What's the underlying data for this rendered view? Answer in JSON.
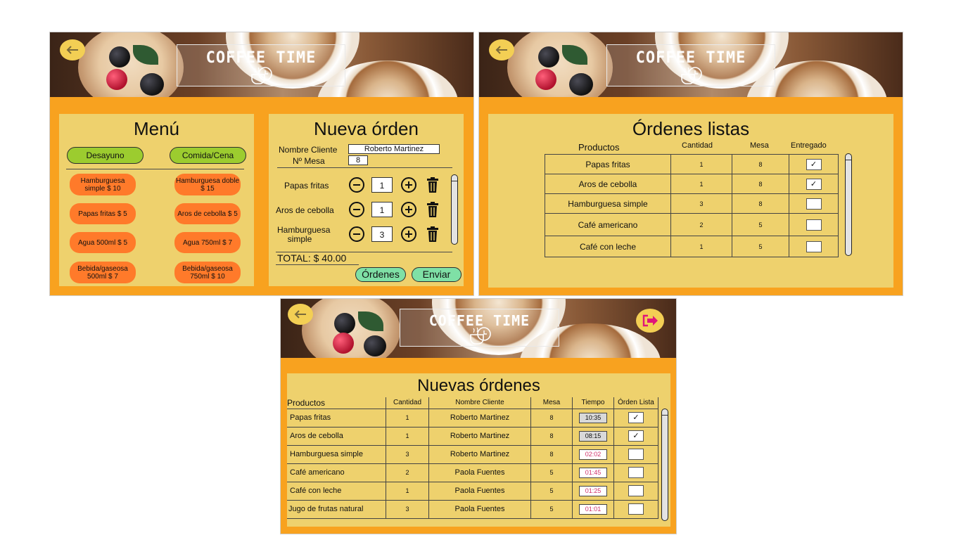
{
  "brand": {
    "title": "COFFEE TIME",
    "logo_icon": "coffee-clock-icon"
  },
  "icons": {
    "back": "arrow-left-icon",
    "exit": "logout-icon",
    "delete": "trash-icon",
    "minus": "minus-circle-icon",
    "plus": "plus-circle-icon"
  },
  "colors": {
    "background": "#f8a21f",
    "panel": "#eed16d",
    "menu_tab": "#9ccc2f",
    "menu_item": "#ff7a2a",
    "action_button": "#7fe0a6",
    "late_time": "#d0306a"
  },
  "order_screen": {
    "menu": {
      "title": "Menú",
      "tabs": [
        "Desayuno",
        "Comida/Cena"
      ],
      "items": [
        [
          "Hamburguesa simple $ 10",
          "Hamburguesa doble $ 15"
        ],
        [
          "Papas fritas $ 5",
          "Aros de cebolla $ 5"
        ],
        [
          "Agua 500ml $ 5",
          "Agua 750ml $ 7"
        ],
        [
          "Bebida/gaseosa 500ml $ 7",
          "Bebida/gaseosa 750ml $ 10"
        ]
      ]
    },
    "new_order": {
      "title": "Nueva órden",
      "client_label": "Nombre Cliente",
      "client_value": "Roberto Martinez",
      "table_label": "Nº Mesa",
      "table_value": "8",
      "lines": [
        {
          "product": "Papas fritas",
          "qty": "1"
        },
        {
          "product": "Aros de cebolla",
          "qty": "1"
        },
        {
          "product": "Hamburguesa simple",
          "qty": "3"
        }
      ],
      "total": "TOTAL:  $ 40.00",
      "orders_button": "Órdenes",
      "send_button": "Enviar"
    }
  },
  "ready_screen": {
    "title": "Órdenes listas",
    "columns": [
      "Productos",
      "Cantidad",
      "Mesa",
      "Entregado"
    ],
    "rows": [
      {
        "product": "Papas fritas",
        "qty": "1",
        "table": "8",
        "delivered": "✓"
      },
      {
        "product": "Aros de cebolla",
        "qty": "1",
        "table": "8",
        "delivered": "✓"
      },
      {
        "product": "Hamburguesa simple",
        "qty": "3",
        "table": "8",
        "delivered": ""
      },
      {
        "product": "Café americano",
        "qty": "2",
        "table": "5",
        "delivered": ""
      },
      {
        "product": "Café con leche",
        "qty": "1",
        "table": "5",
        "delivered": ""
      }
    ]
  },
  "kitchen_screen": {
    "title": "Nuevas órdenes",
    "columns": [
      "Productos",
      "Cantidad",
      "Nombre Cliente",
      "Mesa",
      "Tiempo",
      "Órden Lista"
    ],
    "rows": [
      {
        "product": "Papas fritas",
        "qty": "1",
        "client": "Roberto Martinez",
        "table": "8",
        "time": "10:35",
        "late": false,
        "ready": "✓"
      },
      {
        "product": "Aros de cebolla",
        "qty": "1",
        "client": "Roberto Martinez",
        "table": "8",
        "time": "08:15",
        "late": false,
        "ready": "✓"
      },
      {
        "product": "Hamburguesa simple",
        "qty": "3",
        "client": "Roberto Martinez",
        "table": "8",
        "time": "02:02",
        "late": true,
        "ready": ""
      },
      {
        "product": "Café americano",
        "qty": "2",
        "client": "Paola Fuentes",
        "table": "5",
        "time": "01:45",
        "late": true,
        "ready": ""
      },
      {
        "product": "Café con leche",
        "qty": "1",
        "client": "Paola Fuentes",
        "table": "5",
        "time": "01:25",
        "late": true,
        "ready": ""
      },
      {
        "product": "Jugo de frutas natural",
        "qty": "3",
        "client": "Paola Fuentes",
        "table": "5",
        "time": "01:01",
        "late": true,
        "ready": ""
      }
    ]
  }
}
